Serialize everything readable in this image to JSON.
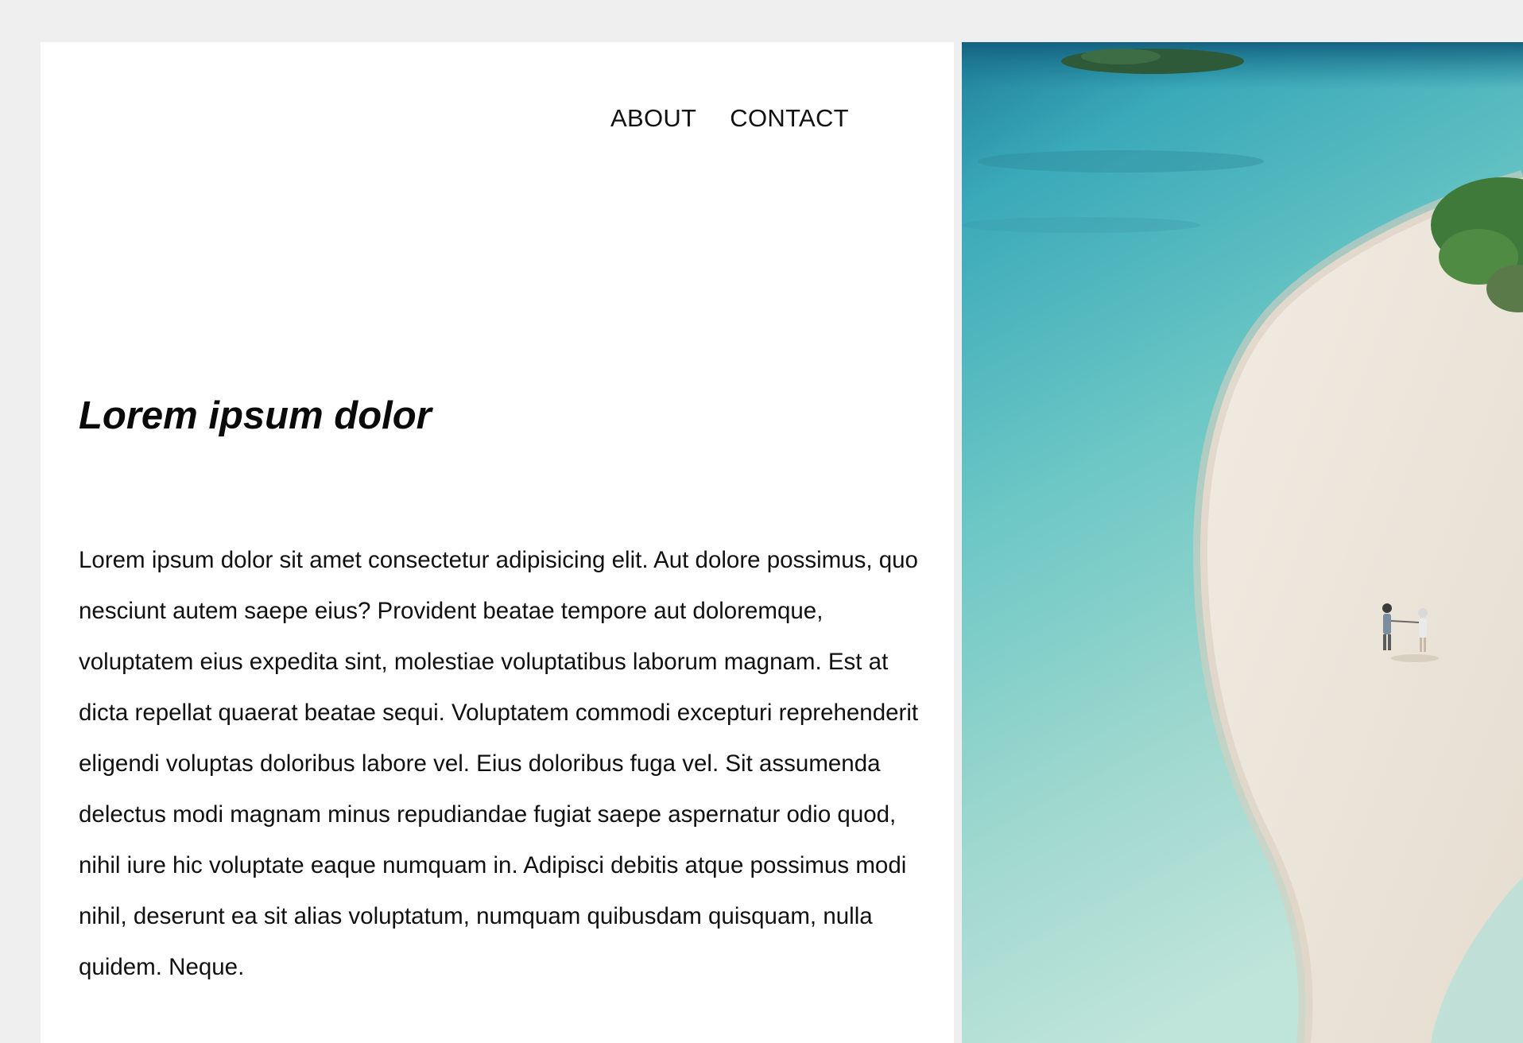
{
  "nav": {
    "about_label": "ABOUT",
    "contact_label": "CONTACT"
  },
  "main": {
    "heading": "Lorem ipsum dolor",
    "body": "Lorem ipsum dolor sit amet consectetur adipisicing elit. Aut dolore possimus, quo nesciunt autem saepe eius? Provident beatae tempore aut doloremque, voluptatem eius expedita sint, molestiae voluptatibus laborum magnam. Est at dicta repellat quaerat beatae sequi. Voluptatem commodi excepturi reprehenderit eligendi voluptas doloribus labore vel. Eius doloribus fuga vel. Sit assumenda delectus modi magnam minus repudiandae fugiat saepe aspernatur odio quod, nihil iure hic voluptate eaque numquam in. Adipisci debitis atque possimus modi nihil, deserunt ea sit alias voluptatum, numquam quibusdam quisquam, nulla quidem. Neque."
  },
  "colors": {
    "page_background": "#efefef",
    "panel_background": "#ffffff",
    "text": "#111111"
  }
}
